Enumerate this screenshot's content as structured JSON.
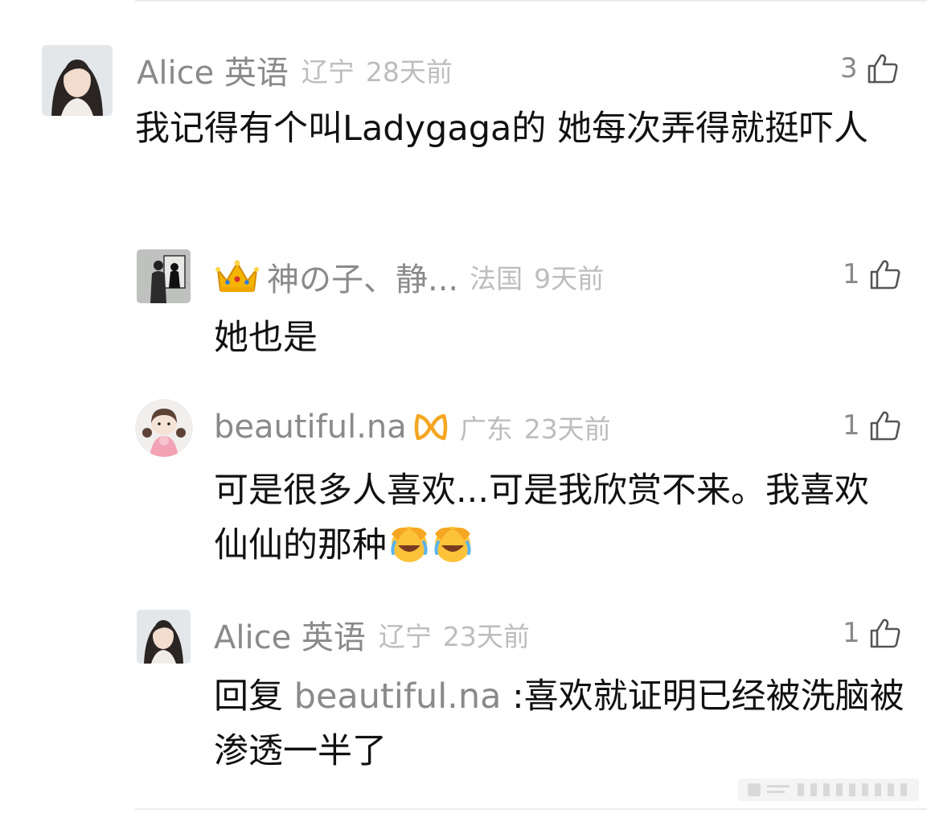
{
  "comments": [
    {
      "username": "Alice 英语",
      "location": "辽宁",
      "time": "28天前",
      "likes": "3",
      "text": "我记得有个叫Ladygaga的 她每次弄得就挺吓人"
    },
    {
      "username": "神の子、静...",
      "badge": "crown-icon",
      "location": "法国",
      "time": "9天前",
      "likes": "1",
      "text": "她也是"
    },
    {
      "username": "beautiful.na",
      "badge": "vip-icon",
      "location": "广东",
      "time": "23天前",
      "likes": "1",
      "text": "可是很多人喜欢...可是我欣赏不来。我喜欢仙仙的那种",
      "emojis": [
        "facepalm-cry-icon",
        "facepalm-cry-icon"
      ]
    },
    {
      "username": "Alice 英语",
      "location": "辽宁",
      "time": "23天前",
      "likes": "1",
      "reply_prefix": "回复",
      "reply_target": "beautiful.na",
      "text": ":喜欢就证明已经被洗脑被渗透一半了"
    }
  ],
  "colors": {
    "username": "#8a8a8a",
    "meta": "#bdbdbd",
    "body_text": "#111111",
    "divider": "#ececec"
  }
}
